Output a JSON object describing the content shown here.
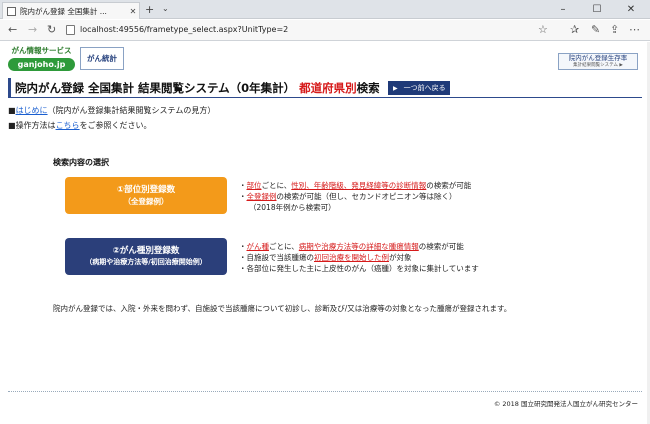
{
  "browser": {
    "tab_title": "院内がん登録 全国集計 ...",
    "url": "localhost:49556/frametype_select.aspx?UnitType=2"
  },
  "header": {
    "brand_top": "がん情報サービス",
    "brand_site": "ganjoho.jp",
    "stat_button": "がん統計",
    "survival_button_line1": "院内がん登録生存率",
    "survival_button_line2": "集計結果閲覧システム ▶"
  },
  "title": {
    "main": "院内がん登録 全国集計 結果閲覧システム（0年集計）",
    "highlight": "都道府県別",
    "suffix": "検索",
    "back_button": "一つ前へ戻る"
  },
  "info": {
    "bullet": "■",
    "intro_link": "はじめに",
    "intro_rest": "（院内がん登録集計結果閲覧システムの見方）",
    "howto_prefix": "操作方法は",
    "howto_link": "こちら",
    "howto_suffix": "をご参照ください。"
  },
  "section": {
    "heading": "検索内容の選択"
  },
  "options": [
    {
      "line1": "①部位別登録数",
      "line2": "（全登録例）",
      "desc": [
        {
          "a": "・",
          "b": "部位",
          "c": "ごとに、",
          "d": "性別、年齢階級、発見経緯等の診断情報",
          "e": "の検索が可能"
        },
        {
          "a": "・",
          "b": "全登録例",
          "c": "の検索が可能（但し、セカンドオピニオン等は除く）"
        },
        {
          "a": "（2018年例から検索可）"
        }
      ]
    },
    {
      "line1": "②がん種別登録数",
      "line2": "（病期や治療方法等/初回治療開始例）",
      "desc": [
        {
          "a": "・",
          "b": "がん種",
          "c": "ごとに、",
          "d": "病期や治療方法等の詳細な腫瘍情報",
          "e": "の検索が可能"
        },
        {
          "a": "・自施設で当該腫瘍の",
          "b": "初回治療を開始した例",
          "c": "が対象"
        },
        {
          "a": "・各部位に発生した主に上皮性のがん（癌腫）を対象に集計しています"
        }
      ]
    }
  ],
  "footnote": "院内がん登録では、入院・外来を問わず、自施設で当該腫瘍について初診し、診断及び/又は治療等の対象となった腫瘍が登録されます。",
  "copyright": "© 2018 国立研究開発法人国立がん研究センター"
}
